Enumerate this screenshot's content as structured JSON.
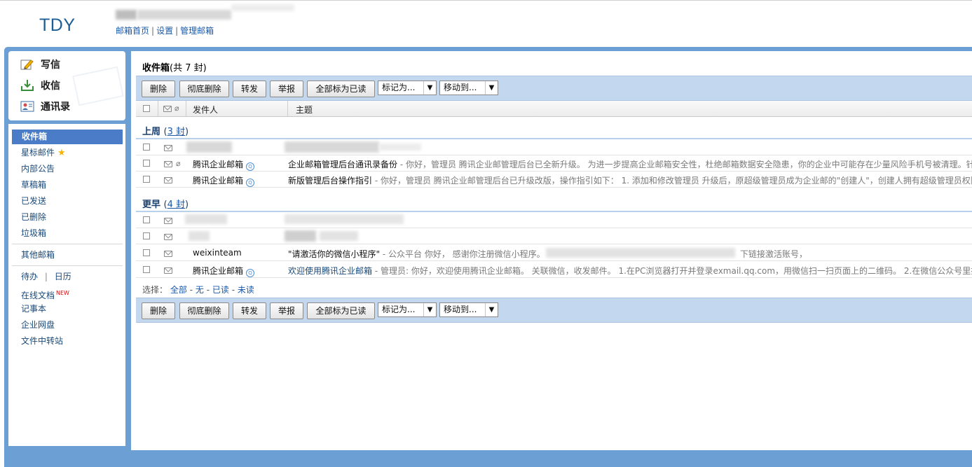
{
  "header": {
    "logo": "TDY",
    "links": [
      "邮箱首页",
      "设置",
      "管理邮箱"
    ],
    "separator": "|"
  },
  "quick": [
    {
      "label": "写信",
      "icon": "compose-icon"
    },
    {
      "label": "收信",
      "icon": "receive-icon"
    },
    {
      "label": "通讯录",
      "icon": "contacts-icon"
    }
  ],
  "folders": {
    "inbox": "收件箱",
    "starred": "星标邮件",
    "notice": "内部公告",
    "drafts": "草稿箱",
    "sent": "已发送",
    "deleted": "已删除",
    "spam": "垃圾箱",
    "other": "其他邮箱",
    "todo": "待办",
    "calendar": "日历",
    "docs": "在线文档",
    "new_badge": "NEW",
    "notes": "记事本",
    "disk": "企业网盘",
    "transfer": "文件中转站",
    "sep": "|"
  },
  "main": {
    "title": "收件箱",
    "count": "(共 7 封)"
  },
  "toolbar": {
    "delete": "删除",
    "purge": "彻底删除",
    "forward": "转发",
    "report": "举报",
    "mark_all_read": "全部标为已读",
    "mark_as": "标记为...",
    "move_to": "移动到...",
    "arrow": "▼"
  },
  "columns": {
    "sender": "发件人",
    "subject": "主题"
  },
  "groups": [
    {
      "label": "上周",
      "open": "(",
      "count": "3 封",
      "close": ")"
    },
    {
      "label": "更早",
      "open": "(",
      "count": "4 封",
      "close": ")"
    }
  ],
  "rows": [
    {
      "sender": "",
      "subject": "",
      "preview": ""
    },
    {
      "sender": "腾讯企业邮箱",
      "subject": "企业邮箱管理后台通讯录备份",
      "preview": " - 你好，管理员 腾讯企业邮管理后台已全新升级。 为进一步提高企业邮箱安全性，杜绝邮箱数据安全隐患，你的企业中可能存在少量风险手机号被清理。针对"
    },
    {
      "sender": "腾讯企业邮箱",
      "subject": "新版管理后台操作指引",
      "preview": " - 你好，管理员 腾讯企业邮管理后台已升级改版，操作指引如下： 1. 添加和修改管理员 升级后，原超级管理员成为企业邮的\"创建人\"，创建人拥有超级管理员权限"
    },
    {
      "sender": "",
      "subject": "",
      "preview": ""
    },
    {
      "sender": "",
      "subject": "",
      "preview": ""
    },
    {
      "sender": "weixinteam",
      "subject": "\"请激活你的微信小程序\"",
      "preview": " - 公众平台 你好， 感谢你注册微信小程序。",
      "tail": "下链接激活账号，"
    },
    {
      "sender": "腾讯企业邮箱",
      "subject": "欢迎使用腾讯企业邮箱",
      "preview": " - 管理员: 你好，欢迎使用腾讯企业邮箱。 关联微信，收发邮件。 1.在PC浏览器打开并登录exmail.qq.com，用微信扫一扫页面上的二维码。 2.在微信公众号里搜索"
    }
  ],
  "select_bar": {
    "label": "选择：",
    "all": "全部",
    "none": "无",
    "read": "已读",
    "unread": "未读",
    "dash": "-"
  },
  "colors": {
    "frame": "#6c9fd3",
    "toolbar": "#c3d8ef",
    "active_folder": "#4a7cc7",
    "logo": "#1c5e95",
    "link": "#1a58a6"
  }
}
